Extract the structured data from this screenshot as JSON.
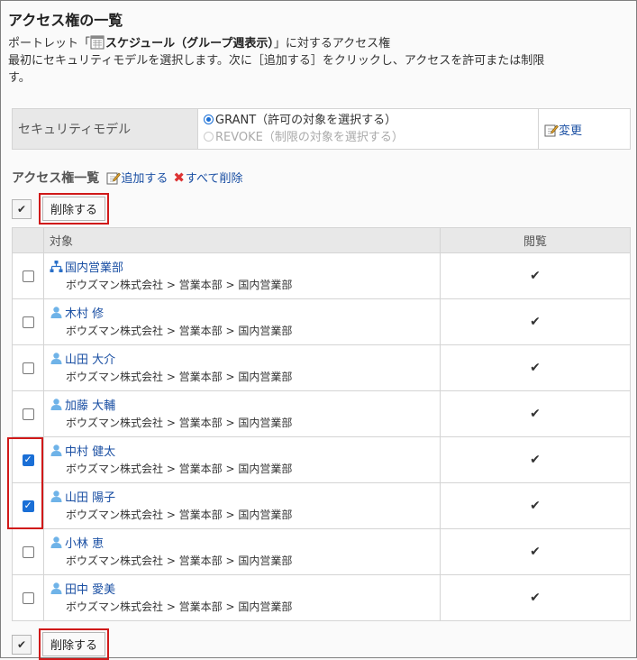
{
  "page": {
    "title": "アクセス権の一覧",
    "desc_prefix": "ポートレット「",
    "portlet_name": "スケジュール（グループ週表示）",
    "desc_suffix": "」に対するアクセス権",
    "desc_line2": "最初にセキュリティモデルを選択します。次に［追加する］をクリックし、アクセスを許可または制限",
    "desc_line3": "す。"
  },
  "security_model": {
    "label": "セキュリティモデル",
    "grant": "GRANT（許可の対象を選択する）",
    "revoke": "REVOKE（制限の対象を選択する）",
    "change": "変更"
  },
  "list": {
    "heading": "アクセス権一覧",
    "add": "追加する",
    "delete_all": "すべて削除",
    "delete_button": "削除する",
    "check_mark": "✔",
    "col_target": "対象",
    "col_view": "閲覧"
  },
  "rows": [
    {
      "name": "国内営業部",
      "type": "org",
      "path": "ボウズマン株式会社 > 営業本部 > 国内営業部",
      "checked": false,
      "view": "✔"
    },
    {
      "name": "木村 修",
      "type": "user",
      "path": "ボウズマン株式会社 > 営業本部 > 国内営業部",
      "checked": false,
      "view": "✔"
    },
    {
      "name": "山田 大介",
      "type": "user",
      "path": "ボウズマン株式会社 > 営業本部 > 国内営業部",
      "checked": false,
      "view": "✔"
    },
    {
      "name": "加藤 大輔",
      "type": "user",
      "path": "ボウズマン株式会社 > 営業本部 > 国内営業部",
      "checked": false,
      "view": "✔"
    },
    {
      "name": "中村 健太",
      "type": "user",
      "path": "ボウズマン株式会社 > 営業本部 > 国内営業部",
      "checked": true,
      "view": "✔"
    },
    {
      "name": "山田 陽子",
      "type": "user",
      "path": "ボウズマン株式会社 > 営業本部 > 国内営業部",
      "checked": true,
      "view": "✔"
    },
    {
      "name": "小林 恵",
      "type": "user",
      "path": "ボウズマン株式会社 > 営業本部 > 国内営業部",
      "checked": false,
      "view": "✔"
    },
    {
      "name": "田中 愛美",
      "type": "user",
      "path": "ボウズマン株式会社 > 営業本部 > 国内営業部",
      "checked": false,
      "view": "✔"
    }
  ],
  "colors": {
    "accent": "#1a6fd6",
    "link": "#1a4fa3",
    "highlight": "#d01919"
  }
}
